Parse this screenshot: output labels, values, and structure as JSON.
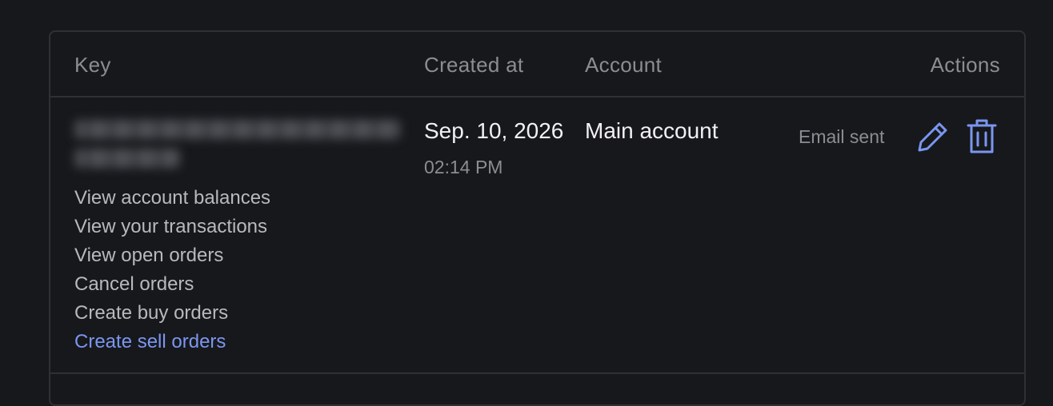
{
  "table": {
    "headers": {
      "key": "Key",
      "created_at": "Created at",
      "account": "Account",
      "actions": "Actions"
    },
    "rows": [
      {
        "key_obscured": true,
        "permissions": [
          "View account balances",
          "View your transactions",
          "View open orders",
          "Cancel orders",
          "Create buy orders",
          "Create sell orders"
        ],
        "created_date": "Sep. 10, 2026",
        "created_time": "02:14 PM",
        "account": "Main account",
        "status": "Email sent",
        "actions": {
          "edit_icon": "pencil-icon",
          "delete_icon": "trash-icon"
        }
      }
    ]
  },
  "colors": {
    "background": "#17181c",
    "border": "#2f3035",
    "accent": "#7b96f0",
    "text_primary": "#f1f1f3",
    "text_secondary": "#8c8d92",
    "text_muted": "#b8b9bd"
  }
}
